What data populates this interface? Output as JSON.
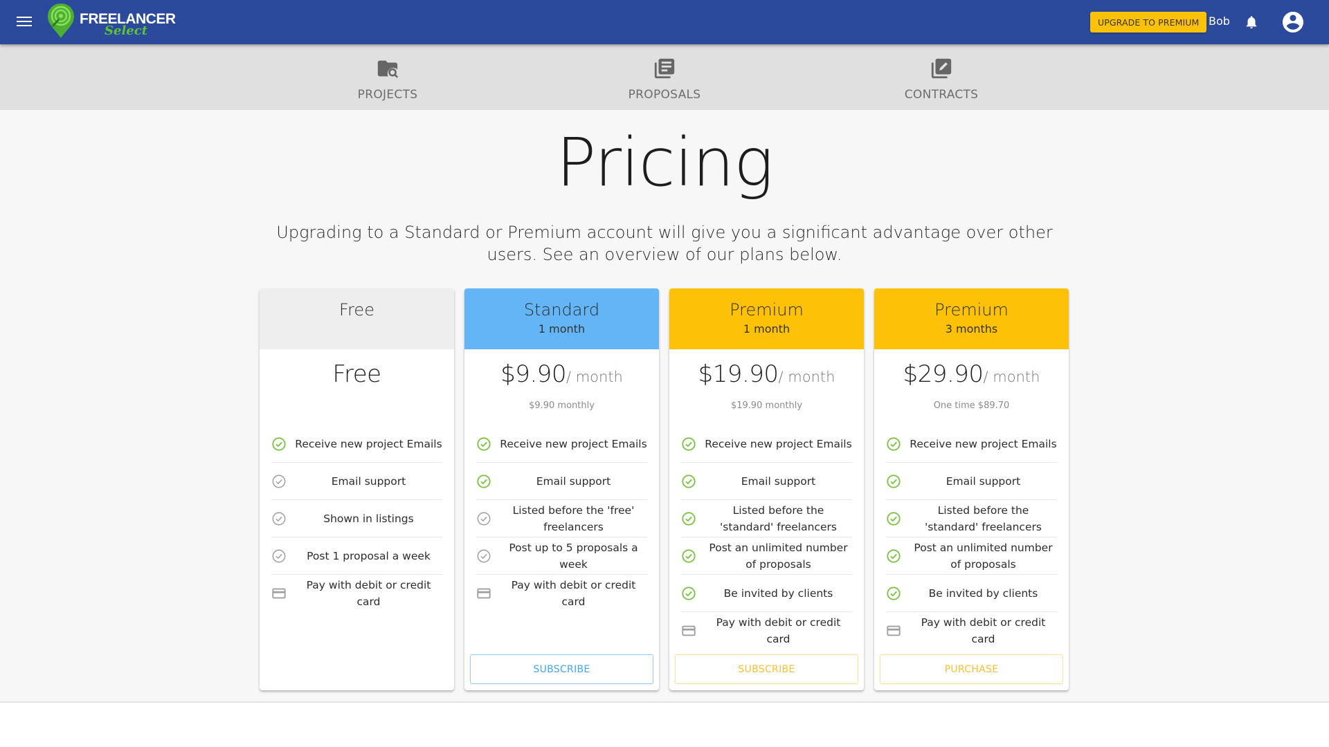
{
  "header": {
    "brand_line1": "FREELANCER",
    "brand_line2": "Select",
    "upgrade_label": "UPGRADE TO PREMIUM",
    "user_name": "Bob",
    "colors": {
      "bar": "#2c4a9c",
      "upgrade": "#fdc107"
    }
  },
  "nav": {
    "tabs": [
      {
        "label": "PROJECTS",
        "icon": "folder-search-icon"
      },
      {
        "label": "PROPOSALS",
        "icon": "library-books-icon"
      },
      {
        "label": "CONTRACTS",
        "icon": "edit-documents-icon"
      }
    ]
  },
  "page": {
    "title": "Pricing",
    "subtitle": "Upgrading to a Standard or Premium account will give you a significant advantage over other users. See an overview of our plans below."
  },
  "plans": [
    {
      "name": "Free",
      "period": "",
      "header_color": "#eeeeee",
      "price": "Free",
      "per": "",
      "note": "",
      "features": [
        {
          "text": "Receive new project Emails",
          "icon": "check-green"
        },
        {
          "text": "Email support",
          "icon": "check-grey"
        },
        {
          "text": "Shown in listings",
          "icon": "check-grey"
        },
        {
          "text": "Post 1 proposal a week",
          "icon": "check-grey"
        },
        {
          "text": "Pay with debit or credit card",
          "icon": "card"
        }
      ],
      "cta": ""
    },
    {
      "name": "Standard",
      "period": "1 month",
      "header_color": "#64b5f6",
      "price": "$9.90",
      "per": "/ month",
      "note": "$9.90 monthly",
      "features": [
        {
          "text": "Receive new project Emails",
          "icon": "check-green"
        },
        {
          "text": "Email support",
          "icon": "check-green"
        },
        {
          "text": "Listed before the 'free' freelancers",
          "icon": "check-grey"
        },
        {
          "text": "Post up to 5 proposals a week",
          "icon": "check-grey"
        },
        {
          "text": "Pay with debit or credit card",
          "icon": "card"
        }
      ],
      "cta": "SUBSCRIBE",
      "cta_color": "#42a5f5",
      "cta_border": "#90caf9"
    },
    {
      "name": "Premium",
      "period": "1 month",
      "header_color": "#fdc107",
      "price": "$19.90",
      "per": "/ month",
      "note": "$19.90 monthly",
      "features": [
        {
          "text": "Receive new project Emails",
          "icon": "check-green"
        },
        {
          "text": "Email support",
          "icon": "check-green"
        },
        {
          "text": "Listed before the 'standard' freelancers",
          "icon": "check-green"
        },
        {
          "text": "Post an unlimited number of proposals",
          "icon": "check-green"
        },
        {
          "text": "Be invited by clients",
          "icon": "check-green"
        },
        {
          "text": "Pay with debit or credit card",
          "icon": "card"
        }
      ],
      "cta": "SUBSCRIBE",
      "cta_color": "#fbc02d",
      "cta_border": "#fde18a"
    },
    {
      "name": "Premium",
      "period": "3 months",
      "header_color": "#fdc107",
      "price": "$29.90",
      "per": "/ month",
      "note": "One time $89.70",
      "features": [
        {
          "text": "Receive new project Emails",
          "icon": "check-green"
        },
        {
          "text": "Email support",
          "icon": "check-green"
        },
        {
          "text": "Listed before the 'standard' freelancers",
          "icon": "check-green"
        },
        {
          "text": "Post an unlimited number of proposals",
          "icon": "check-green"
        },
        {
          "text": "Be invited by clients",
          "icon": "check-green"
        },
        {
          "text": "Pay with debit or credit card",
          "icon": "card"
        }
      ],
      "cta": "PURCHASE",
      "cta_color": "#fbc02d",
      "cta_border": "#fde18a"
    }
  ]
}
